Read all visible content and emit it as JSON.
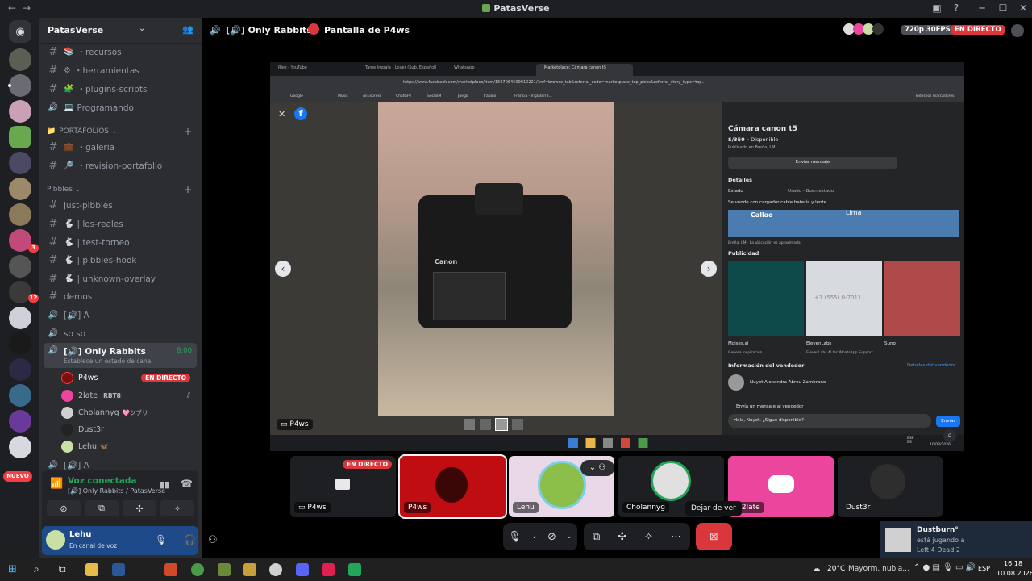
{
  "window": {
    "title": "PatasVerse",
    "back": "←",
    "forward": "→"
  },
  "server_list": {
    "nuevo": "NUEVO",
    "badges": [
      "3",
      "12"
    ]
  },
  "guild": {
    "name": "PatasVerse"
  },
  "channels": {
    "top": [
      {
        "icon": "#",
        "emoji": "📚",
        "label": "・recursos"
      },
      {
        "icon": "#",
        "emoji": "⚙",
        "label": "・herramientas"
      },
      {
        "icon": "#",
        "emoji": "🧩",
        "label": "・plugins-scripts"
      },
      {
        "icon": "🔊",
        "emoji": "💻",
        "label": "Programando"
      }
    ],
    "cat_portafolios": "PORTAFOLIOS",
    "portafolios": [
      {
        "icon": "#",
        "emoji": "💼",
        "label": "・galeria"
      },
      {
        "icon": "#",
        "emoji": "🔎",
        "label": "・revision-portafolio"
      }
    ],
    "cat_pibbles": "Pibbles",
    "pibbles": [
      {
        "icon": "#",
        "emoji": "",
        "label": "just-pibbles"
      },
      {
        "icon": "#",
        "emoji": "🐇",
        "label": "| los-reales"
      },
      {
        "icon": "#",
        "emoji": "🐇",
        "label": "| test-torneo"
      },
      {
        "icon": "#",
        "emoji": "🐇",
        "label": "| pibbles-hook"
      },
      {
        "icon": "#",
        "emoji": "🐇",
        "label": "| unknown-overlay"
      },
      {
        "icon": "#",
        "emoji": "",
        "label": "demos"
      },
      {
        "icon": "🔊",
        "emoji": "",
        "label": "[🔊] A"
      },
      {
        "icon": "🔊",
        "emoji": "",
        "label": "so so"
      }
    ],
    "active": {
      "label": "[🔊] Only Rabbits",
      "timer": "6:00",
      "status": "Establece un estado de canal"
    },
    "voice_users": [
      {
        "name": "P4ws",
        "live": "EN DIRECTO",
        "color": "#7a1010"
      },
      {
        "name": "2late",
        "tag": "RBT8",
        "color": "#eb459e"
      },
      {
        "name": "Cholannyg",
        "tag": "🩷ジブリ",
        "color": "#d0d0d0"
      },
      {
        "name": "Dust3r",
        "color": "#222"
      },
      {
        "name": "Lehu",
        "tag": "🦋",
        "color": "#c9e0a4"
      }
    ],
    "cut_off": "[🔊] A"
  },
  "voice": {
    "connected": "Voz conectada",
    "channel": "[🔊] Only Rabbits / PatasVerse"
  },
  "user": {
    "name": "Lehu",
    "status": "En canal de voz"
  },
  "header": {
    "channel": "[🔊] Only Rabbits",
    "stream": "Pantalla de P4ws",
    "quality": "720p 30FPS",
    "live": "EN DIRECTO"
  },
  "stream": {
    "tabs": [
      "Rjez - YouTube",
      "Tame Impala - Lover (Sub. Español)",
      "WhatsApp",
      "Marketplace: Cámara canon t5"
    ],
    "url": "https://www.facebook.com/marketplace/item/1597064509010221/?ref=browse_tab&referral_code=marketplace_top_picks&referral_story_type=top...",
    "bookmarks": [
      "Google",
      "Music",
      "AliExpress",
      "ChatGPT",
      "SocialM",
      "Juego",
      "Trabajo",
      "Francia - Inglaterra..."
    ],
    "all_bookmarks": "Todos los marcadores",
    "item": {
      "title": "Cámara canon t5",
      "price": "S/350",
      "availability": "· Disponible",
      "location": "Publicado en Breña, LM",
      "send": "Enviar mensaje",
      "details": "Detalles",
      "state_k": "Estado",
      "state_v": "Usado - Buen estado",
      "desc": "Se vende con cargador cable batería y lente",
      "map_city": "Callao",
      "map_city2": "Lima",
      "map_note": "Breña, LM · La ubicación es aproximada",
      "ads": "Publicidad",
      "ad_names": [
        "Moises.ai",
        "ElevenLabs",
        "Suno"
      ],
      "ad_subs": [
        "Genera inspiración",
        "ElevenLabs AI for WhatsApp Support",
        ""
      ],
      "ad_phone": "+1 (555) 0-7011",
      "seller_h": "Información del vendedor",
      "seller_link": "Detalles del vendedor",
      "seller": "Nuyet Alexandra Abreu Zambrano",
      "msg_h": "Envía un mensaje al vendedor",
      "msg": "Hola, Nuyet. ¿Sigue disponible?",
      "msg_btn": "Enviar"
    },
    "cam_brand": "Canon",
    "badge": "P4ws",
    "tray_lang": "ESP\nES",
    "tray_date": "10/08/2026"
  },
  "tiles": [
    {
      "name": "P4ws",
      "live": "EN DIRECTO"
    },
    {
      "name": "P4ws"
    },
    {
      "name": "Lehu"
    },
    {
      "name": "Cholannyg"
    },
    {
      "name": "2late"
    },
    {
      "name": "Dust3r"
    }
  ],
  "tooltip": "Dejar de ver",
  "notification": {
    "name": "Dustburn°",
    "line1": "está jugando a",
    "game": "Left 4 Dead 2"
  },
  "taskbar": {
    "weather": "20°C",
    "weather_desc": "Mayorm. nubla...",
    "lang": "ESP",
    "time": "16:18",
    "date": "10.08.2026"
  }
}
